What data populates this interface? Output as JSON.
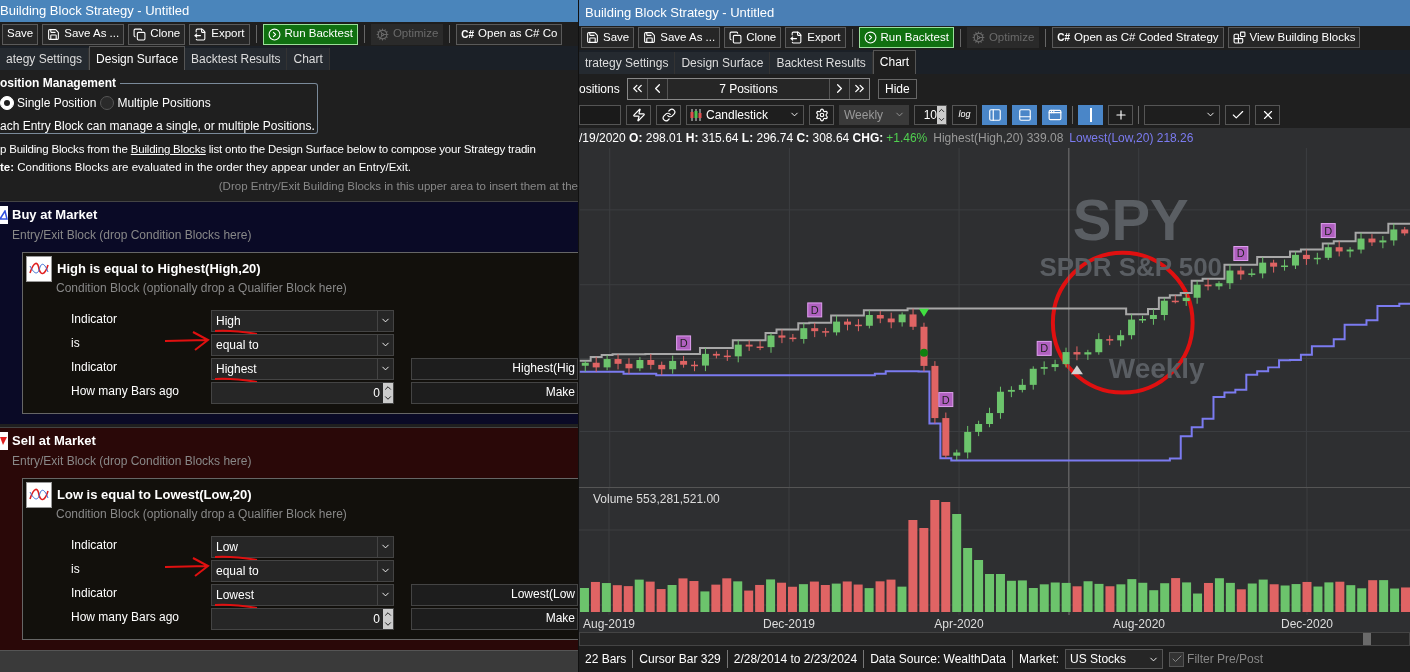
{
  "left_window": {
    "title": "Building Block Strategy - Untitled",
    "toolbar": [
      {
        "kind": "plain",
        "label": "Save"
      },
      {
        "kind": "save",
        "label": "Save As ..."
      },
      {
        "kind": "clone",
        "label": "Clone"
      },
      {
        "kind": "export",
        "label": "Export"
      },
      {
        "kind": "separator"
      },
      {
        "kind": "run",
        "label": "Run Backtest"
      },
      {
        "kind": "separator"
      },
      {
        "kind": "optimize",
        "label": "Optimize",
        "disabled": true
      },
      {
        "kind": "separator"
      },
      {
        "kind": "code",
        "icon_text": "C#",
        "label": "Open as C# Co"
      }
    ],
    "tabs": [
      {
        "label": "ategy Settings",
        "selected": false
      },
      {
        "label": "Design Surface",
        "selected": true
      },
      {
        "label": "Backtest Results",
        "selected": false
      },
      {
        "label": "Chart",
        "selected": false
      }
    ],
    "position_management": {
      "title": "osition Management",
      "options": [
        {
          "label": "Single Position",
          "selected": true
        },
        {
          "label": "Multiple Positions",
          "selected": false
        }
      ],
      "note": "ach Entry Block can manage a single, or multiple Positions."
    },
    "instructions": {
      "before": "p Building Blocks from the",
      "link": "Building Blocks",
      "after": "list onto the Design Surface below to compose your Strategy tradin"
    },
    "note": "**te:** Conditions Blocks are evaluated in the order they appear under an Entry/Exit.",
    "drop_hint": "(Drop Entry/Exit Building Blocks in this upper area to insert them at the",
    "blocks": [
      {
        "kind": "buy",
        "title": "Buy at Market",
        "subtitle": "Entry/Exit Block (drop Condition Blocks here)",
        "condition": {
          "title": "High is equal to Highest(High,20)",
          "subtitle": "Condition Block (optionally drop a Qualifier Block here)",
          "rows": [
            {
              "label": "Indicator",
              "kind": "dropdown",
              "value": "High",
              "underlined": true
            },
            {
              "label": "is",
              "kind": "dropdown",
              "value": "equal to",
              "pointed": true
            },
            {
              "label": "Indicator",
              "kind": "dropdown",
              "value": "Highest",
              "side": "Highest(Hig",
              "underlined": true
            },
            {
              "label": "How many Bars ago",
              "kind": "spinner",
              "value": "0",
              "side": "Make"
            }
          ]
        }
      },
      {
        "kind": "sell",
        "title": "Sell at Market",
        "subtitle": "Entry/Exit Block (drop Condition Blocks here)",
        "condition": {
          "title": "Low is equal to Lowest(Low,20)",
          "subtitle": "Condition Block (optionally drop a Qualifier Block here)",
          "rows": [
            {
              "label": "Indicator",
              "kind": "dropdown",
              "value": "Low",
              "underlined": true
            },
            {
              "label": "is",
              "kind": "dropdown",
              "value": "equal to",
              "pointed": true
            },
            {
              "label": "Indicator",
              "kind": "dropdown",
              "value": "Lowest",
              "side": "Lowest(Low",
              "underlined": true
            },
            {
              "label": "How many Bars ago",
              "kind": "spinner",
              "value": "0",
              "side": "Make"
            }
          ]
        }
      }
    ]
  },
  "right_window": {
    "title": "Building Block Strategy - Untitled",
    "toolbar": [
      {
        "kind": "save",
        "label": "Save"
      },
      {
        "kind": "save",
        "label": "Save As ..."
      },
      {
        "kind": "clone",
        "label": "Clone"
      },
      {
        "kind": "export",
        "label": "Export"
      },
      {
        "kind": "separator"
      },
      {
        "kind": "run",
        "label": "Run Backtest"
      },
      {
        "kind": "separator"
      },
      {
        "kind": "optimize",
        "label": "Optimize",
        "disabled": true
      },
      {
        "kind": "separator"
      },
      {
        "kind": "code",
        "icon_text": "C#",
        "label": "Open as C# Coded Strategy"
      },
      {
        "kind": "blocks",
        "label": "View Building Blocks"
      }
    ],
    "tabs": [
      {
        "label": "trategy Settings",
        "selected": false
      },
      {
        "label": "Design Surface",
        "selected": false
      },
      {
        "label": "Backtest Results",
        "selected": false
      },
      {
        "label": "Chart",
        "selected": true
      }
    ],
    "positions": {
      "label": "ositions",
      "value": "7 Positions",
      "hide": "Hide"
    },
    "chart_toolbar": [
      {
        "kind": "field"
      },
      {
        "kind": "bolt"
      },
      {
        "kind": "link"
      },
      {
        "kind": "chart-type",
        "value": "Candlestick",
        "disabled": false
      },
      {
        "kind": "gear"
      },
      {
        "kind": "dropdown",
        "value": "Weekly",
        "disabled": true
      },
      {
        "kind": "spinner",
        "value": "10"
      },
      {
        "kind": "log",
        "label": "log"
      },
      {
        "kind": "panel-left",
        "selected": true
      },
      {
        "kind": "panel-bottom",
        "selected": true
      },
      {
        "kind": "window",
        "selected": true
      },
      {
        "kind": "separator"
      },
      {
        "kind": "line",
        "selected": true
      },
      {
        "kind": "plus",
        "selected": false
      },
      {
        "kind": "separator"
      },
      {
        "kind": "dropdown",
        "disabled": false
      },
      {
        "kind": "confirm"
      },
      {
        "kind": "cancel"
      }
    ],
    "ohlc": "/19/2020 **O:** 298.01 **H:** 315.64 **L:** 296.74 **C:** 308.64 **CHG:**",
    "change": {
      "value": "+1.46%",
      "positive": true
    },
    "indicators": [
      {
        "text": "Highest(High,20) 339.08",
        "color": "#9a9a9a"
      },
      {
        "text": "Lowest(Low,20) 218.26",
        "color": "#7b7bf0"
      }
    ],
    "chart": {
      "symbol": "SPY",
      "name": "SPDR S&P 500",
      "scale": "Weekly",
      "markers": [
        {
          "label": "D"
        },
        {
          "label": "D"
        },
        {
          "label": "D"
        },
        {
          "label": "D"
        },
        {
          "label": "D"
        },
        {
          "label": "D"
        }
      ],
      "circled": true
    },
    "volume_label": "Volume 553,281,521.00",
    "x_labels": [
      "Aug-2019",
      "Dec-2019",
      "Apr-2020",
      "Aug-2020",
      "Dec-2020"
    ],
    "status_bar": [
      "22 Bars",
      "Cursor Bar 329",
      "2/28/2014 to 2/23/2024",
      "Data Source: WealthData"
    ],
    "market": {
      "label": "Market:",
      "value": "US Stocks"
    },
    "filter": {
      "label": "Filter Pre/Post",
      "checked": true
    }
  }
}
